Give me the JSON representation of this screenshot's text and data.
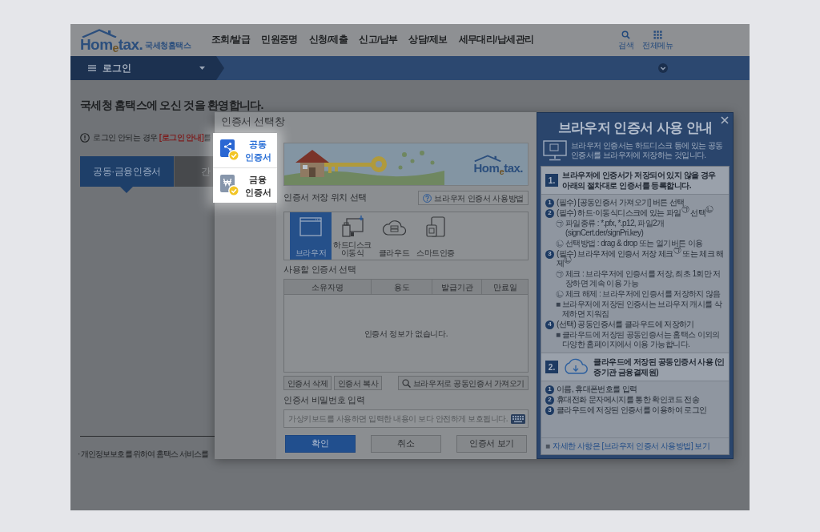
{
  "header": {
    "logo": "Hom$_{e}$tax.",
    "logo_subtitle": "국세청홈택스",
    "nav": [
      "조회/발급",
      "민원증명",
      "신청/제출",
      "신고/납부",
      "상담/제보",
      "세무대리/납세관리"
    ],
    "tools": [
      "검색",
      "전체메뉴"
    ]
  },
  "login_bar": {
    "label": "로그인"
  },
  "content": {
    "welcome": "국세청 홈택스에 오신 것을 환영합니다.",
    "notice": {
      "text": "로그인 안되는 경우 ",
      "link": "[로그인 안내]",
      "after": "를"
    },
    "tabs": [
      {
        "label": "공동·금융인증서",
        "selected": true
      },
      {
        "label": "간",
        "selected": false
      }
    ],
    "privacy_note": "· 개인정보보호를 위하여 홈택스 서비스를"
  },
  "cert_dialog": {
    "title": "인증서 선택창",
    "cert_types": [
      {
        "label": "공동 인증서",
        "selected": true
      },
      {
        "label": "금융 인증서",
        "selected": false
      }
    ],
    "banner_logo": "Hom$_{e}$tax.",
    "storage_label": "인증서 저장 위치 선택",
    "help_button": "브라우저 인증서 사용방법",
    "storage_options": [
      {
        "label": "브라우저",
        "selected": true
      },
      {
        "label": "하드디스크 이동식",
        "selected": false
      },
      {
        "label": "클라우드",
        "selected": false
      },
      {
        "label": "스마트인증",
        "selected": false
      }
    ],
    "cert_list_label": "사용할 인증서 선택",
    "table": {
      "columns": [
        "소유자명",
        "용도",
        "발급기관",
        "만료일"
      ],
      "empty_message": "인증서 정보가 없습니다."
    },
    "list_buttons": [
      "인증서 삭제",
      "인증서 복사"
    ],
    "import_button": "브라우저로 공동인증서 가져오기",
    "password_label": "인증서 비밀번호 입력",
    "password_field": {
      "placeholder": "가상키보드를 사용하면 입력한 내용이 보다 안전하게 보호됩니다."
    },
    "actions": [
      {
        "label": "확인",
        "kind": "primary"
      },
      {
        "label": "취소",
        "kind": "secondary"
      },
      {
        "label": "인증서 보기",
        "kind": "secondary"
      }
    ]
  },
  "guide": {
    "title": "브라우저 인증서 사용 안내",
    "intro": "브라우저 인증서는 하드디스크 등에 있는 공동인증서를 브라우저에 저장하는 것입니다.",
    "sections": [
      {
        "number": "1.",
        "heading": "브라우저에 인증서가 저장되어 있지 않을 경우 아래의 절차대로 인증서를 등록합니다.",
        "steps": [
          {
            "number": "1",
            "text": "(필수) [공동인증서 가져오기] 버튼 선택"
          },
          {
            "number": "2",
            "text": "(필수) 하드·이동식디스크에 있는 파일$^{㉠}$ 선택$^{㉡}$",
            "notes": [
              {
                "marker": "㉠",
                "text": "파일종류 : *.pfx, *.p12, 파일2개 (signCert.der/signPri.key)"
              },
              {
                "marker": "㉡",
                "text": "선택방법 : drag & drop 또는 열기버튼 이용"
              }
            ]
          },
          {
            "number": "3",
            "text": "(필수) 브라우저에 인증서 저장 체크$^{㉠}$ 또는 체크 해제$^{㉡}$",
            "notes": [
              {
                "marker": "㉠",
                "text": "체크 : 브라우저에 인증서를 저장, 최초 1회만 저장하면 계속 이용 가능"
              },
              {
                "marker": "㉡",
                "text": "체크 해제 : 브라우저에 인증서를 저장하지 않음"
              },
              {
                "marker": "■",
                "text": "브라우저에 저장된 인증서는 브라우저 캐시를 삭제하면 지워짐"
              }
            ]
          },
          {
            "number": "4",
            "text": "(선택) 공동인증서를 클라우드에 저장하기",
            "notes": [
              {
                "marker": "■",
                "text": "클라우드에 저장된 공동인증서는 홈택스 이외의 다양한 홈페이지에서 이용 가능합니다."
              }
            ]
          }
        ]
      },
      {
        "number": "2.",
        "heading": "클라우드에 저장된 공동인증서 사용 (인증기관 금융결제원)",
        "steps": [
          {
            "number": "1",
            "text": "이름, 휴대폰번호를 입력"
          },
          {
            "number": "2",
            "text": "휴대전화 문자메시지를 통한 확인코드 전송"
          },
          {
            "number": "3",
            "text": "클라우드에 저장된 인증서를 이용하여 로그인"
          }
        ]
      }
    ],
    "footer": {
      "marker": "■",
      "link": "자세한 사항은 [브라우저 인증서 사용방법] 보기"
    }
  }
}
